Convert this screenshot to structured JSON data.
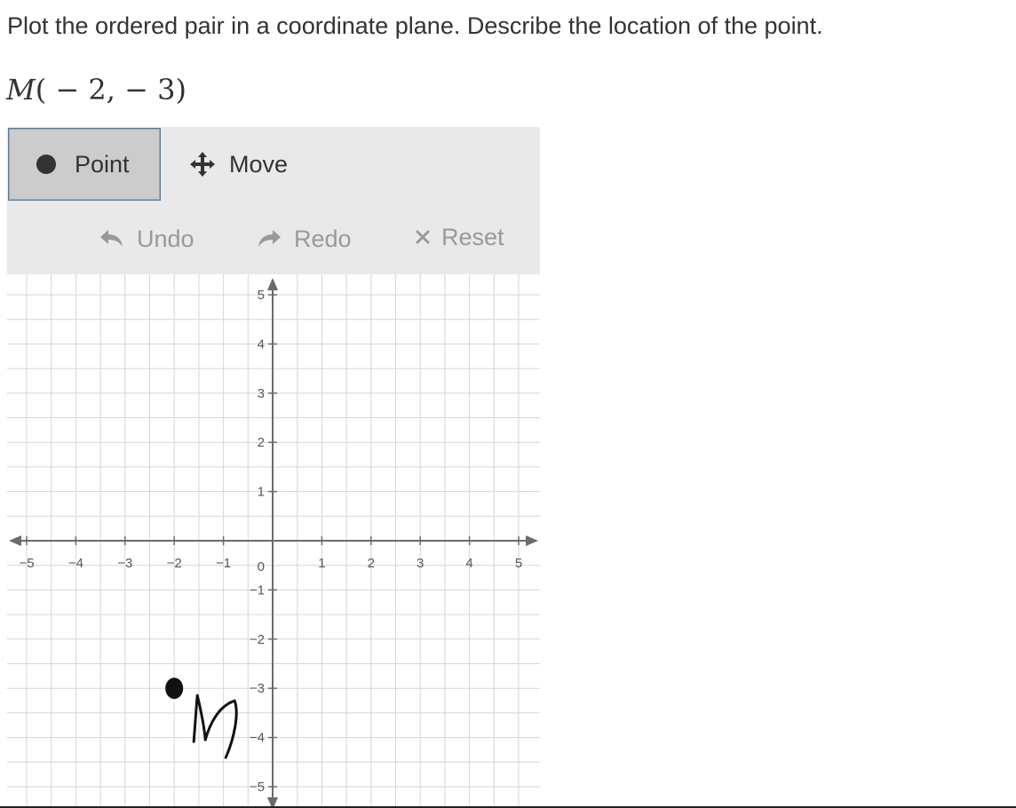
{
  "question": {
    "prompt": "Plot the ordered pair in a coordinate plane. Describe the location of the point.",
    "point_name": "M",
    "point_coords": "( − 2, − 3)"
  },
  "toolbar": {
    "tools": [
      {
        "label": "Point",
        "icon": "filled-circle-icon",
        "selected": true
      },
      {
        "label": "Move",
        "icon": "move-arrows-icon",
        "selected": false
      }
    ],
    "actions": [
      {
        "label": "Undo",
        "icon": "undo-arrow-icon",
        "enabled": false
      },
      {
        "label": "Redo",
        "icon": "redo-arrow-icon",
        "enabled": false
      },
      {
        "label": "Reset",
        "icon": "x-icon",
        "enabled": false
      }
    ],
    "colors": {
      "bar": "#e9e9e9",
      "selected": "#cccccc",
      "selected_border": "#3f7fb8",
      "disabled_text": "#999999"
    }
  },
  "graph": {
    "x_range": [
      -5,
      5
    ],
    "y_range": [
      -5,
      5
    ],
    "minor_step": 0.5,
    "x_tick_labels": [
      "−5",
      "−4",
      "−3",
      "−2",
      "−1",
      "1",
      "2",
      "3",
      "4",
      "5"
    ],
    "y_tick_labels": [
      "5",
      "4",
      "3",
      "2",
      "1",
      "−1",
      "−2",
      "−3",
      "−4",
      "−5"
    ],
    "origin_label": "0",
    "plotted_point": {
      "x": -2,
      "y": -3
    },
    "handwritten_annotation": "M",
    "colors": {
      "grid": "#d6d6d6",
      "axis": "#6b6b6b",
      "point": "#111111"
    }
  }
}
